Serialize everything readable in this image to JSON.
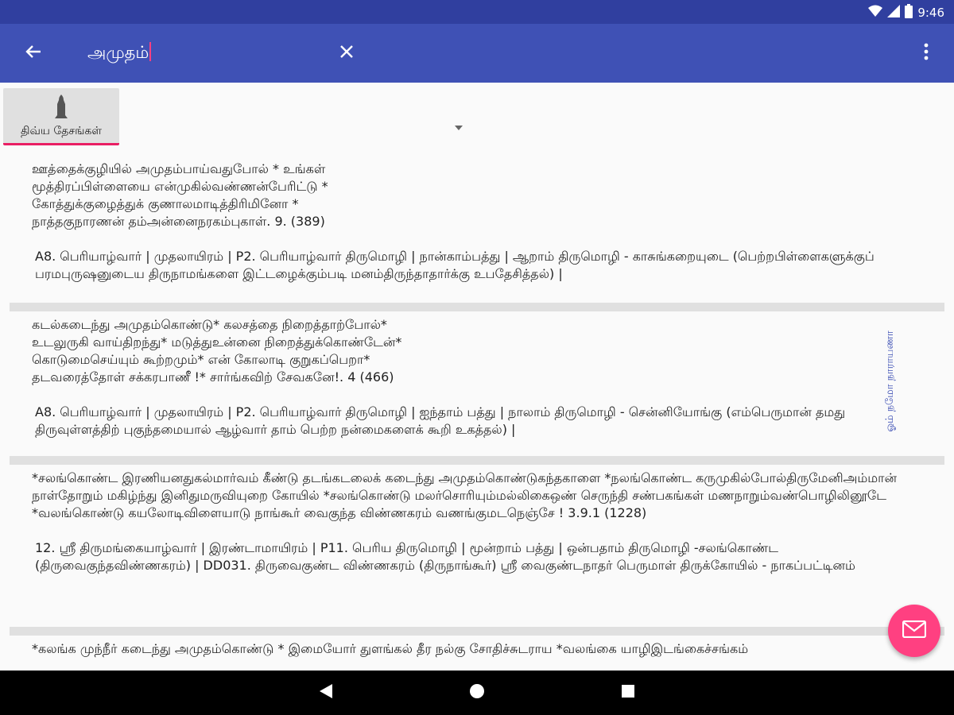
{
  "status": {
    "time": "9:46"
  },
  "search": {
    "query": "அமுதம்"
  },
  "filter": {
    "category_label": "திவ்ய தேசங்கள்"
  },
  "side_label": "ஓம் நமோ நாராயணா",
  "results": [
    {
      "verse": "ஊத்தைக்குழியில் அமுதம்பாய்வதுபோல் * உங்கள்\nமூத்திரப்பிள்ளையை என்முகில்வண்ணன்பேரிட்டு *\nகோத்துக்குழைத்துக் குணாலமாடித்திரிமினோ *\nநாத்தகுநாரணன் தம்அன்னைநரகம்புகாள். 9. (389)",
      "source": "A8. பெரியாழ்வார் | முதலாயிரம் | P2. பெரியாழ்வார் திருமொழி | நான்காம்பத்து | ஆறாம் திருமொழி - காசுங்கறையுடை (பெற்றபிள்ளைகளுக்குப் பரமபுருஷனுடைய திருநாமங்களை இட்டழைக்கும்படி மனம்திருந்தாதார்க்கு உபதேசித்தல்) |"
    },
    {
      "verse": "கடல்கடைந்து அமுதம்கொண்டு* கலசத்தை நிறைத்தாற்போல்*\nஉடலுருகி வாய்திறந்து* மடுத்துஉன்னை நிறைத்துக்கொண்டேன்*\nகொடுமைசெய்யும் கூற்றமும்* என் கோலாடி குறுகப்பெறா*\nதடவரைத்தோள் சக்கரபாணீ !* சார்ங்கவிற் சேவகனே!. 4 (466)",
      "source": "A8. பெரியாழ்வார் | முதலாயிரம் | P2. பெரியாழ்வார் திருமொழி | ஐந்தாம் பத்து | நாலாம் திருமொழி - சென்னியோங்கு (எம்பெருமான் தமது திருவுள்ளத்திற் புகுந்தமையால் ஆழ்வார் தாம் பெற்ற நன்மைகளைக் கூறி உகத்தல்) |"
    },
    {
      "verse": "*சலங்கொண்ட இரணியனதுகல்மார்வம் கீண்டு தடங்கடலைக் கடைந்து அமுதம்கொண்டுகந்தகாளை *நலங்கொண்ட கருமுகில்போல்திருமேனிஅம்மான் நாள்தோறும் மகிழ்ந்து இனிதுமருவியுறை கோயில் *சலங்கொண்டு மலர்சொரியும்மல்லிகைஒண் செருந்தி சண்பகங்கள் மணநாறும்வண்பொழிலினூடே *வலங்கொண்டு கயலோடிவிளையாடு நாங்கூர் வைகுந்த விண்ணகரம் வணங்குமடநெஞ்சே ! 3.9.1 (1228)",
      "source": "12. ஸ்ரீ திருமங்கையாழ்வார் | இரண்டாமாயிரம் | P11. பெரிய திருமொழி | மூன்றாம் பத்து | ஒன்பதாம் திருமொழி -சலங்கொண்ட (திருவைகுந்தவிண்ணகரம்) | DD031. திருவைகுண்ட விண்ணகரம் (திருநாங்கூர்) ஸ்ரீ வைகுண்டநாதர் பெருமாள் திருக்கோயில் - நாகப்பட்டினம்"
    },
    {
      "verse": "*கலங்க முந்நீர் கடைந்து அமுதம்கொண்டு * இமையோர் துளங்கல் தீர நல்கு சோதிச்சுடராய *வலங்கை யாழிஇடங்கைச்சங்கம்",
      "source": ""
    }
  ]
}
